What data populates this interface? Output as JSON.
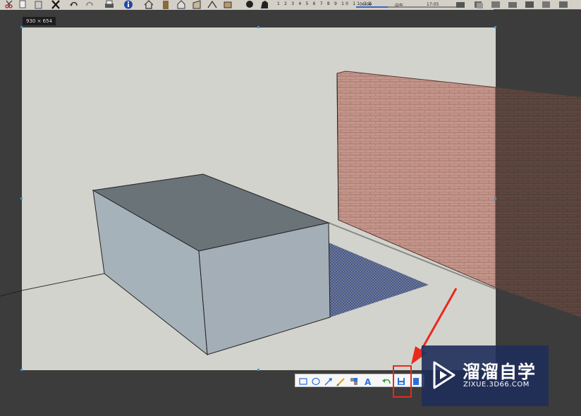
{
  "toolbar": {
    "scene_numbers": "1 2 3 4 5 6 7 8 9 10 11 12",
    "time_start": "06:09",
    "time_mid": "中午",
    "time_end": "17:05",
    "time_slider_level": 0.3
  },
  "selection": {
    "size_label": "930 × 654"
  },
  "snip_toolbar": {
    "tools": [
      "rectangle-icon",
      "ellipse-icon",
      "arrow-icon",
      "pencil-icon",
      "mosaic-icon",
      "text-icon",
      "undo-icon",
      "save-icon",
      "copy-icon"
    ]
  },
  "watermark": {
    "title": "溜溜自学",
    "url": "ZIXUE.3D66.COM"
  },
  "colors": {
    "desktop": "#3c3c3c",
    "viewport": "#d3d3cd",
    "box_top": "#6a7378",
    "box_side": "#a6b2ba",
    "wall": "#c4958a",
    "shadow_hatch": "#4a5a8c",
    "callout": "#e8291e",
    "selection_handle": "#2e9cd8"
  }
}
